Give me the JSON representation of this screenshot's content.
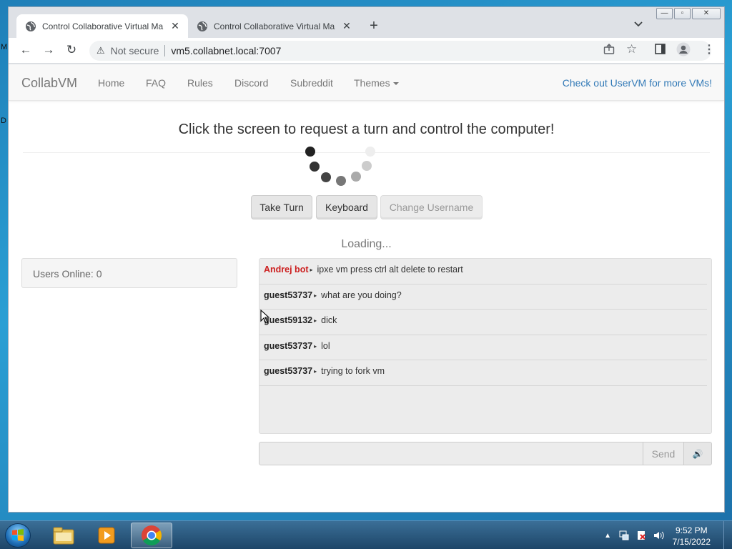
{
  "desktop": {
    "left_labels": [
      "M",
      "D"
    ]
  },
  "browser": {
    "tabs": [
      {
        "title": "Control Collaborative Virtual Ma",
        "active": true
      },
      {
        "title": "Control Collaborative Virtual Ma",
        "active": false
      }
    ],
    "new_tab": "+",
    "tab_search": "⌄",
    "window_controls": {
      "minimize": "—",
      "restore": "▫",
      "close": "✕"
    },
    "nav": {
      "back": "←",
      "forward": "→",
      "reload": "↻"
    },
    "security_label": "Not secure",
    "url": "vm5.collabnet.local:7007"
  },
  "site": {
    "brand": "CollabVM",
    "nav_items": [
      "Home",
      "FAQ",
      "Rules",
      "Discord",
      "Subreddit",
      "Themes"
    ],
    "nav_right": "Check out UserVM for more VMs!",
    "headline": "Click the screen to request a turn and control the computer!",
    "buttons": {
      "take_turn": "Take Turn",
      "keyboard": "Keyboard",
      "change_username": "Change Username"
    },
    "loading": "Loading...",
    "users_online": "Users Online: 0",
    "send": "Send",
    "volume_icon": "🔊"
  },
  "chat": {
    "messages": [
      {
        "user": "Andrej bot",
        "text": "ipxe vm press ctrl alt delete to restart",
        "bot": true
      },
      {
        "user": "guest53737",
        "text": "what are you doing?",
        "bot": false
      },
      {
        "user": "guest59132",
        "text": "dick",
        "bot": false
      },
      {
        "user": "guest53737",
        "text": "lol",
        "bot": false
      },
      {
        "user": "guest53737",
        "text": "trying to fork vm",
        "bot": false
      }
    ]
  },
  "taskbar": {
    "items": [
      "start-orb",
      "file-explorer-icon",
      "media-player-icon",
      "chrome-icon"
    ],
    "time": "9:52 PM",
    "date": "7/15/2022"
  },
  "colors": {
    "link": "#337ab7",
    "bot_name": "#cc1e1e",
    "taskbar": "#1d4568"
  }
}
